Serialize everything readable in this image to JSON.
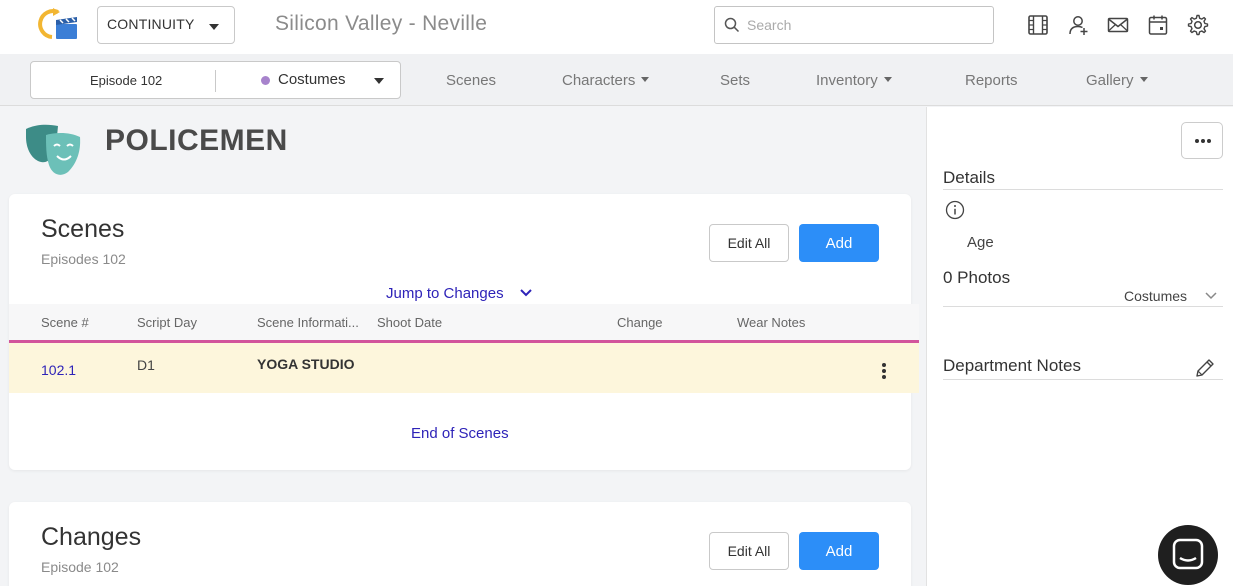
{
  "header": {
    "app_select": "CONTINUITY",
    "project_title": "Silicon Valley - Neville",
    "search_placeholder": "Search",
    "icons": [
      "film-icon",
      "add-user-icon",
      "mail-icon",
      "calendar-icon",
      "settings-icon"
    ]
  },
  "nav": {
    "episode": "Episode 102",
    "department": "Costumes",
    "department_color": "#a783cc",
    "items": [
      {
        "label": "Scenes",
        "dropdown": false
      },
      {
        "label": "Characters",
        "dropdown": true
      },
      {
        "label": "Sets",
        "dropdown": false
      },
      {
        "label": "Inventory",
        "dropdown": true
      },
      {
        "label": "Reports",
        "dropdown": false
      },
      {
        "label": "Gallery",
        "dropdown": true
      }
    ]
  },
  "page": {
    "title": "POLICEMEN",
    "icon": "theater-masks-icon"
  },
  "scenes_card": {
    "title": "Scenes",
    "subtitle": "Episodes 102",
    "edit_all": "Edit All",
    "add": "Add",
    "jump_label": "Jump to Changes",
    "columns": [
      "Scene #",
      "Script Day",
      "Scene Informati...",
      "Shoot Date",
      "Change",
      "Wear Notes"
    ],
    "rows": [
      {
        "scene": "102.1",
        "script_day": "D1",
        "info": "YOGA STUDIO",
        "shoot_date": "",
        "change": "",
        "wear_notes": ""
      }
    ],
    "end_label": "End of Scenes"
  },
  "changes_card": {
    "title": "Changes",
    "subtitle": "Episode 102",
    "edit_all": "Edit All",
    "add": "Add"
  },
  "right_panel": {
    "details_heading": "Details",
    "age_label": "Age",
    "photos_heading": "0 Photos",
    "photos_filter": "Costumes",
    "notes_heading": "Department Notes"
  },
  "colors": {
    "primary_button": "#2c8ef8",
    "link": "#2e23b8",
    "row_highlight": "#fdf6dc",
    "table_accent_line": "#d2549c",
    "logo_teal": "#4a9f9a"
  }
}
